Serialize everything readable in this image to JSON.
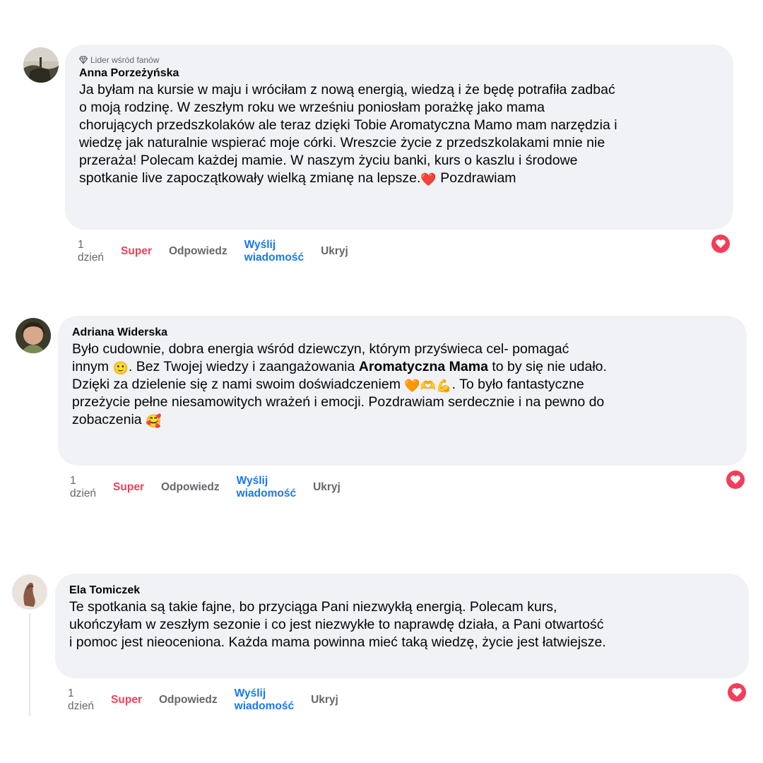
{
  "comments": [
    {
      "badge": "Lider wśród fanów",
      "author": "Anna Porzeżyńska",
      "text_parts": [
        "Ja byłam na kursie w maju i wróciłam z nową energią, wiedzą i że będę potrafiła zadbać",
        "o moją rodzinę. W zeszłym roku we wrześniu poniosłam porażkę jako mama",
        "chorujących przedszkolaków ale teraz dzięki Tobie Aromatyczna Mamo mam narzędzia i",
        "wiedzę jak naturalnie wspierać moje córki. Wreszcie życie z przedszkolakami mnie nie",
        "przeraża! Polecam każdej mamie. W naszym życiu banki, kurs o kaszlu i środowe",
        "spotkanie live zapoczątkowały wielką zmianę na lepsze.",
        " Pozdrawiam"
      ],
      "emoji_heart": "❤️",
      "time": "1 dzień",
      "reaction_label": "Super",
      "reply_label": "Odpowiedz",
      "message_label": "Wyślij wiadomość",
      "hide_label": "Ukryj",
      "reaction_icon": "love-reaction-icon"
    },
    {
      "author": "Adriana Widerska",
      "line1": "Było cudownie, dobra energia wśród dziewczyn, którym przyświeca cel- pomagać",
      "line2_a": "innym ",
      "emoji_smile": "🙂",
      "line2_b": ". Bez Twojej wiedzy i zaangażowania ",
      "line2_bold": "Aromatyczna Mama",
      "line2_c": " to by się nie udało.",
      "line3_a": "Dzięki za dzielenie się z nami swoim doświadczeniem ",
      "emoji_set": "🧡🫶💪",
      "line3_b": ". To było fantastyczne",
      "line4": "przeżycie pełne niesamowitych wrażeń i emocji. Pozdrawiam serdecznie i na pewno do",
      "line5_a": "zobaczenia ",
      "emoji_hearts": "🥰",
      "time": "1 dzień",
      "reaction_label": "Super",
      "reply_label": "Odpowiedz",
      "message_label": "Wyślij wiadomość",
      "hide_label": "Ukryj"
    },
    {
      "author": "Ela Tomiczek",
      "lines": [
        "Te spotkania są takie fajne, bo przyciąga Pani niezwykłą energią. Polecam kurs,",
        "ukończyłam w zeszłym sezonie i co jest niezwykłe to naprawdę działa, a Pani otwartość",
        "i pomoc jest nieoceniona. Każda mama powinna mieć taką wiedzę, życie jest łatwiejsze."
      ],
      "time": "1 dzień",
      "reaction_label": "Super",
      "reply_label": "Odpowiedz",
      "message_label": "Wyślij wiadomość",
      "hide_label": "Ukryj"
    }
  ],
  "colors": {
    "bubble": "#f0f2f5",
    "super": "#f33e58",
    "link": "#1877f2",
    "meta": "#65676b"
  }
}
